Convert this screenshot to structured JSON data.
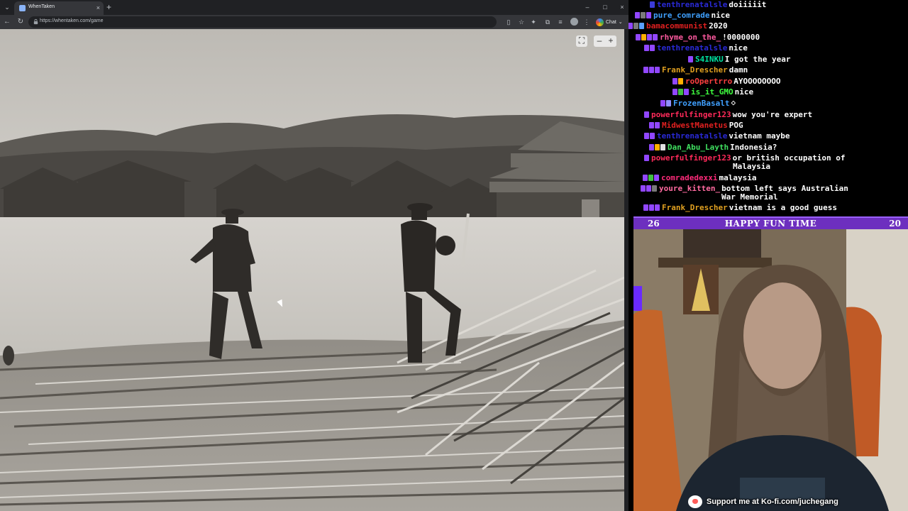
{
  "browser": {
    "tab_title": "WhenTaken",
    "url": "https://whentaken.com/game",
    "chat_label": "Chat",
    "controls": {
      "close": "×",
      "new_tab": "+",
      "minimize": "–",
      "maximize": "□",
      "window_close": "×"
    }
  },
  "game": {
    "zoom_out": "–",
    "zoom_in": "+"
  },
  "chat": {
    "messages": [
      {
        "user": "tenthrenatalsle",
        "user_color": "#2a2ad8",
        "text": "doiiiiit",
        "badges": [
          "#3b3bd8"
        ]
      },
      {
        "user": "pure_comrade",
        "user_color": "#3fa0ff",
        "text": "nice",
        "badges": [
          "#9147ff",
          "#7a7a7a",
          "#9147ff"
        ]
      },
      {
        "user": "bamacommunist",
        "user_color": "#e02020",
        "text": "2020",
        "badges": [
          "#9147ff",
          "#7a7a7a",
          "#5aa0ff"
        ]
      },
      {
        "user": "rhyme_on_the_",
        "user_color": "#ff5aa0",
        "text": "!0000000",
        "badges": [
          "#9147ff",
          "#ffb000",
          "#9147ff",
          "#9147ff"
        ]
      },
      {
        "user": "tenthrenatalsle",
        "user_color": "#2a2ad8",
        "text": "nice",
        "badges": [
          "#9147ff",
          "#9147ff"
        ]
      },
      {
        "user": "S4INKU",
        "user_color": "#00e0a0",
        "text": "I got the year",
        "badges": [
          "#9147ff"
        ]
      },
      {
        "user": "Frank_Drescher",
        "user_color": "#e0a020",
        "text": "damn",
        "badges": [
          "#9147ff",
          "#9147ff",
          "#9147ff"
        ]
      },
      {
        "user": "roOpertrro",
        "user_color": "#ff4040",
        "text": "AYOOOOOOOO",
        "badges": [
          "#9147ff",
          "#ffb000"
        ]
      },
      {
        "user": "is_it_GMO",
        "user_color": "#40ff40",
        "text": "nice",
        "badges": [
          "#9147ff",
          "#40c040",
          "#9147ff"
        ]
      },
      {
        "user": "FrozenBasalt",
        "user_color": "#40a0ff",
        "text": "⋄",
        "badges": [
          "#9147ff",
          "#9090ff"
        ]
      },
      {
        "user": "powerfulfinger123",
        "user_color": "#ff2a5a",
        "text": "wow you're expert",
        "badges": [
          "#9147ff"
        ]
      },
      {
        "user": "MidwestManetus",
        "user_color": "#e02020",
        "text": "POG",
        "badges": [
          "#9147ff",
          "#9147ff"
        ]
      },
      {
        "user": "tenthrenatalsle",
        "user_color": "#2a2ad8",
        "text": "vietnam maybe",
        "badges": [
          "#9147ff",
          "#9147ff"
        ]
      },
      {
        "user": "Dan_Abu_Layth",
        "user_color": "#40e060",
        "text": "Indonesia?",
        "badges": [
          "#9147ff",
          "#ffb000",
          "#e0e0e0"
        ]
      },
      {
        "user": "powerfulfinger123",
        "user_color": "#ff2a5a",
        "text": "or british occupation of",
        "text2": "Malaysia",
        "badges": [
          "#9147ff"
        ]
      },
      {
        "user": "comradedexxi",
        "user_color": "#ff2a7a",
        "text": "malaysia",
        "badges": [
          "#9147ff",
          "#40c040",
          "#9147ff"
        ]
      },
      {
        "user": "youre_kitten_",
        "user_color": "#ff6aa0",
        "text": "bottom left says Australian",
        "text2": "War Memorial",
        "badges": [
          "#9147ff",
          "#9147ff",
          "#7a7a7a"
        ]
      },
      {
        "user": "Frank_Drescher",
        "user_color": "#e0a020",
        "text": "vietnam is a good guess",
        "badges": [
          "#9147ff",
          "#9147ff",
          "#9147ff"
        ]
      }
    ]
  },
  "banner": {
    "left_num": "26",
    "title": "HAPPY FUN TIME",
    "right_num": "20"
  },
  "kofi": {
    "text": "Support me at Ko-fi.com/juchegang"
  }
}
